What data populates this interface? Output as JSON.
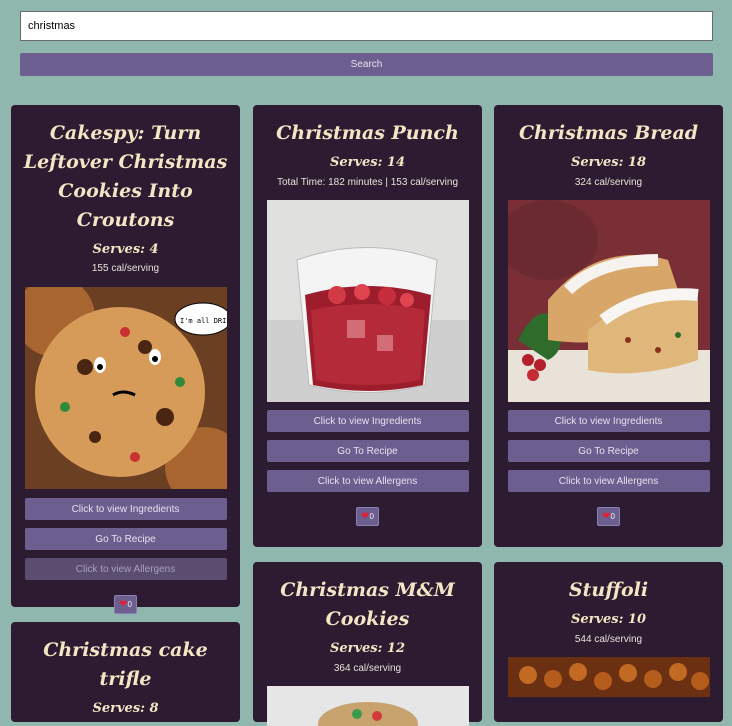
{
  "search": {
    "value": "christmas",
    "button_label": "Search"
  },
  "cards": [
    {
      "title": "Cakespy: Turn Leftover Christmas Cookies Into Croutons",
      "serves": "Serves: 4",
      "info": "155 cal/serving",
      "ingredients_label": "Click to view Ingredients",
      "recipe_label": "Go To Recipe",
      "allergens_label": "Click to view Allergens",
      "likes": "0"
    },
    {
      "title": "Christmas Punch",
      "serves": "Serves: 14",
      "info": "Total Time: 182 minutes | 153 cal/serving",
      "ingredients_label": "Click to view Ingredients",
      "recipe_label": "Go To Recipe",
      "allergens_label": "Click to view Allergens",
      "likes": "0"
    },
    {
      "title": "Christmas Bread",
      "serves": "Serves: 18",
      "info": "324 cal/serving",
      "ingredients_label": "Click to view Ingredients",
      "recipe_label": "Go To Recipe",
      "allergens_label": "Click to view Allergens",
      "likes": "0"
    },
    {
      "title": "Christmas M&M Cookies",
      "serves": "Serves: 12",
      "info": "364 cal/serving"
    },
    {
      "title": "Stuffoli",
      "serves": "Serves: 10",
      "info": "544 cal/serving"
    },
    {
      "title": "Christmas cake trifle",
      "serves": "Serves: 8"
    }
  ],
  "image_text": {
    "cookie_bubble": "I'm all DRIED o"
  },
  "icons": {
    "like": "heart-icon"
  }
}
